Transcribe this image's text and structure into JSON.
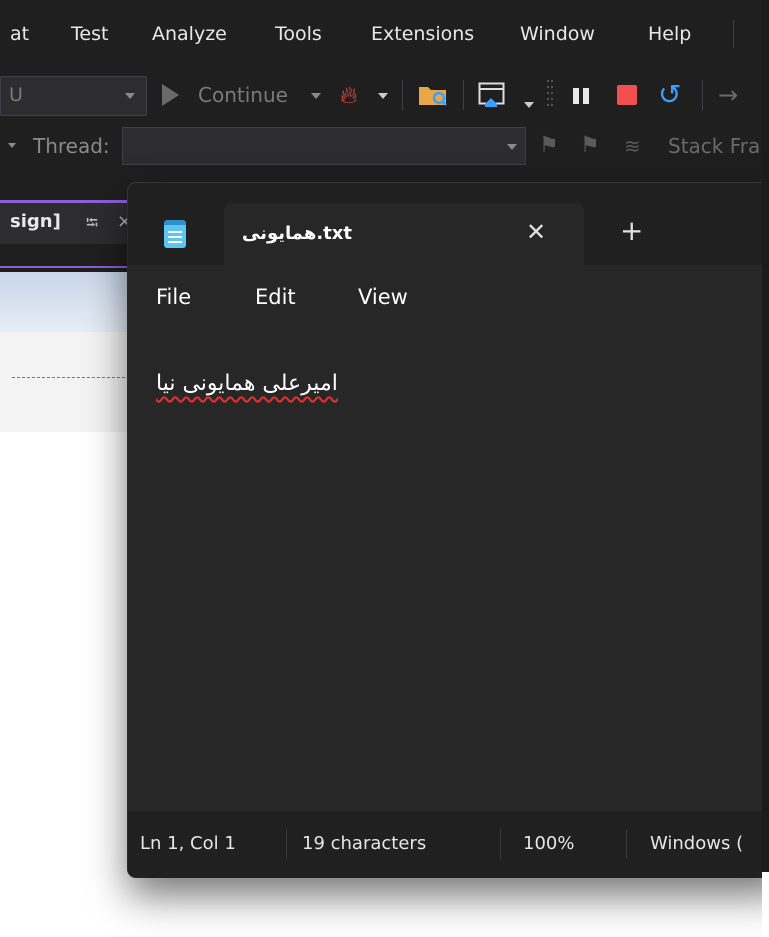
{
  "vs": {
    "menu": [
      "at",
      "Test",
      "Analyze",
      "Tools",
      "Extensions",
      "Window",
      "Help"
    ],
    "toolbar": {
      "config_value": "U",
      "continue_label": "Continue"
    },
    "debugbar": {
      "thread_label": "Thread:",
      "stack_frame_label": "Stack Fra"
    },
    "doc_tab": {
      "label": "sign]",
      "pin_glyph": "⭾",
      "close_glyph": "×"
    }
  },
  "notepad": {
    "tab_title": "همایونی.txt",
    "tab_close_glyph": "✕",
    "new_tab_glyph": "+",
    "menu": [
      "File",
      "Edit",
      "View"
    ],
    "content": "امیرعلی همایونی نیا",
    "status": {
      "position": "Ln 1, Col 1",
      "characters": "19 characters",
      "zoom": "100%",
      "line_ending": "Windows ("
    }
  },
  "icons": {
    "hot_reload": "flame-icon",
    "restart": "restart-icon",
    "stop": "stop-icon",
    "pause": "pause-icon"
  },
  "colors": {
    "vs_accent": "#8b5fd9",
    "stop": "#f05050",
    "restart": "#3aa0ff",
    "hot_reload": "#ff4a3d",
    "notepad_bg": "#272727",
    "spellcheck": "#e03030"
  }
}
